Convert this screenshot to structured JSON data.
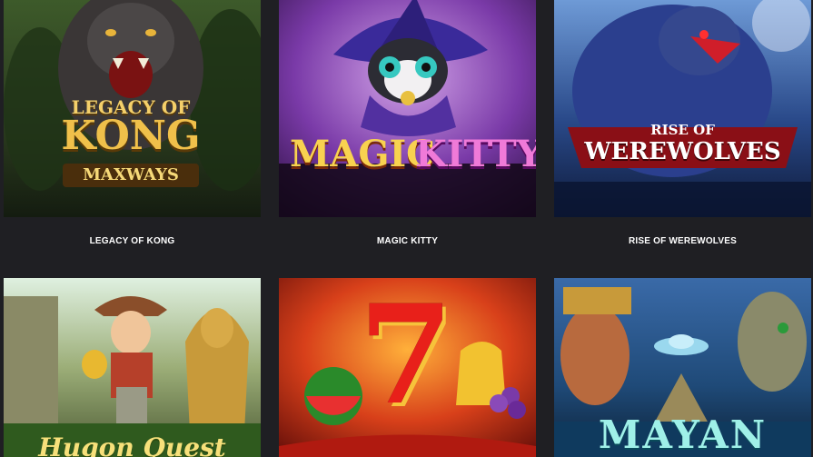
{
  "games": [
    {
      "title": "LEGACY OF KONG",
      "logo_line1": "LEGACY OF",
      "logo_line2": "KONG",
      "logo_line3": "MAXWAYS"
    },
    {
      "title": "MAGIC KITTY",
      "logo_line1": "MAGIC",
      "logo_line2": "KITTY"
    },
    {
      "title": "RISE OF WEREWOLVES",
      "logo_line1": "RISE OF",
      "logo_line2": "WEREWOLVES"
    },
    {
      "title": "",
      "logo_line1": "Hugon Quest"
    },
    {
      "title": "",
      "logo_line1": "7"
    },
    {
      "title": "",
      "logo_line1": "MAYAN"
    }
  ],
  "colors": {
    "page_background": "#1f1f23",
    "caption_text": "#ffffff"
  }
}
